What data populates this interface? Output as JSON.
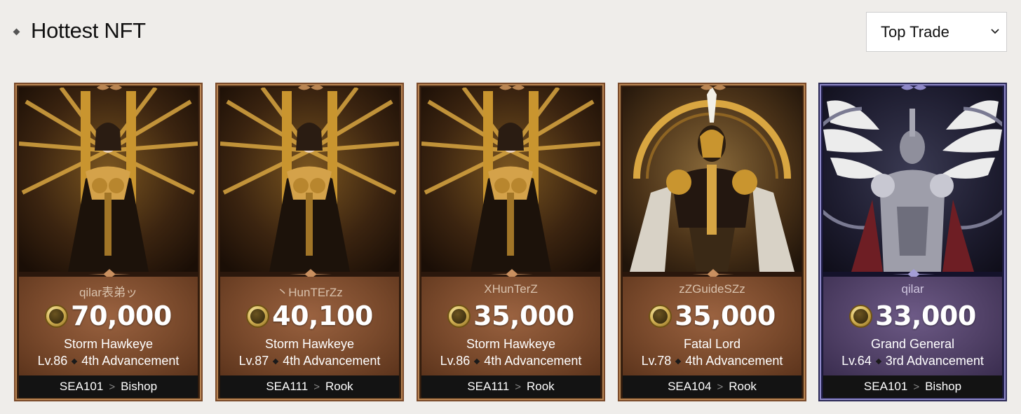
{
  "header": {
    "title": "Hottest NFT"
  },
  "sort": {
    "selected": "Top Trade"
  },
  "cards": [
    {
      "owner": "qilar表弟ッ",
      "price": "70,000",
      "character": "Storm Hawkeye",
      "level": "Lv.86",
      "advancement": "4th Advancement",
      "server": "SEA101",
      "role": "Bishop",
      "theme": "bronze"
    },
    {
      "owner": "丶HunTErZz",
      "price": "40,100",
      "character": "Storm Hawkeye",
      "level": "Lv.87",
      "advancement": "4th Advancement",
      "server": "SEA111",
      "role": "Rook",
      "theme": "bronze"
    },
    {
      "owner": "XHunTerZ",
      "price": "35,000",
      "character": "Storm Hawkeye",
      "level": "Lv.86",
      "advancement": "4th Advancement",
      "server": "SEA111",
      "role": "Rook",
      "theme": "bronze"
    },
    {
      "owner": "zZGuideSZz",
      "price": "35,000",
      "character": "Fatal Lord",
      "level": "Lv.78",
      "advancement": "4th Advancement",
      "server": "SEA104",
      "role": "Rook",
      "theme": "bronze"
    },
    {
      "owner": "qilar",
      "price": "33,000",
      "character": "Grand General",
      "level": "Lv.64",
      "advancement": "3rd Advancement",
      "server": "SEA101",
      "role": "Bishop",
      "theme": "purple"
    }
  ]
}
